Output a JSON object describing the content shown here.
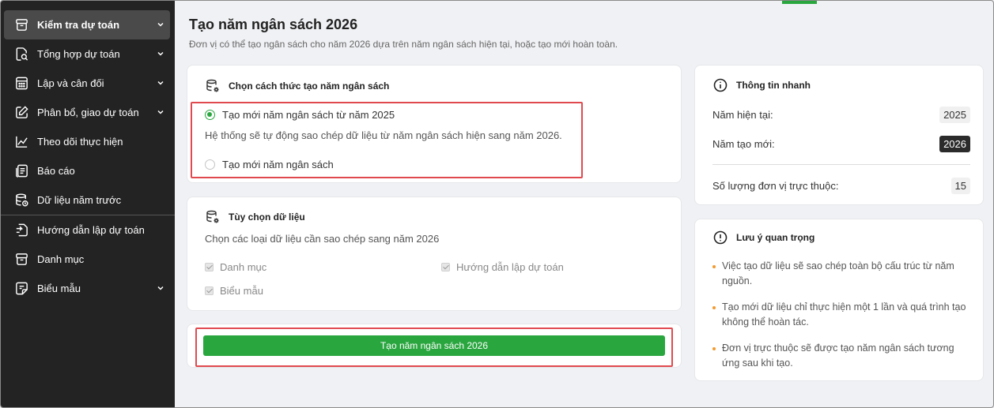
{
  "sidebar": {
    "items": [
      {
        "label": "Kiểm tra dự toán",
        "icon": "box-icon",
        "active": true,
        "has_chevron": true
      },
      {
        "label": "Tổng hợp dự toán",
        "icon": "document-search-icon",
        "has_chevron": true
      },
      {
        "label": "Lập và cân đối",
        "icon": "calculator-icon",
        "has_chevron": true
      },
      {
        "label": "Phân bổ, giao dự toán",
        "icon": "edit-icon",
        "has_chevron": true
      },
      {
        "label": "Theo dõi thực hiện",
        "icon": "line-chart-icon",
        "has_chevron": false
      },
      {
        "label": "Báo cáo",
        "icon": "report-icon",
        "has_chevron": false
      },
      {
        "label": "Dữ liệu năm trước",
        "icon": "database-clock-icon",
        "has_chevron": false
      },
      {
        "label": "Hướng dẫn lập dự toán",
        "icon": "guide-icon",
        "has_chevron": false
      },
      {
        "label": "Danh mục",
        "icon": "box-icon",
        "has_chevron": false
      },
      {
        "label": "Biểu mẫu",
        "icon": "form-icon",
        "has_chevron": true
      }
    ]
  },
  "page": {
    "title": "Tạo năm ngân sách 2026",
    "subtitle": "Đơn vị có thể tạo ngân sách cho năm 2026 dựa trên năm ngân sách hiện tại, hoặc tạo mới hoàn toàn."
  },
  "method_card": {
    "title": "Chọn cách thức tạo năm ngân sách",
    "option_copy": "Tạo mới năm ngân sách từ năm 2025",
    "option_copy_desc": "Hệ thống sẽ tự động sao chép dữ liệu từ năm ngân sách hiện sang năm 2026.",
    "option_new": "Tạo mới năm ngân sách",
    "selected": "option_copy"
  },
  "options_card": {
    "title": "Tùy chọn dữ liệu",
    "description": "Chọn các loại dữ liệu cần sao chép sang năm 2026",
    "checkboxes": {
      "danh_muc": "Danh mục",
      "huong_dan": "Hướng dẫn lập dự toán",
      "bieu_mau": "Biểu mẫu"
    }
  },
  "action": {
    "create_label": "Tạo năm ngân sách 2026"
  },
  "info_card": {
    "title": "Thông tin nhanh",
    "current_year_label": "Năm hiện tại:",
    "current_year_value": "2025",
    "new_year_label": "Năm tạo mới:",
    "new_year_value": "2026",
    "units_label": "Số lượng đơn vị trực thuộc:",
    "units_value": "15"
  },
  "notes_card": {
    "title": "Lưu ý quan trọng",
    "notes": [
      "Việc tạo dữ liệu sẽ sao chép toàn bộ cấu trúc từ năm nguồn.",
      "Tạo mới dữ liệu chỉ thực hiện một 1 lần và quá trình tạo không thể hoàn tác.",
      "Đơn vị trực thuộc sẽ được tạo năm ngân sách tương ứng sau khi tạo."
    ]
  },
  "colors": {
    "accent": "#2aa63f",
    "highlight_border": "#e04a4f",
    "sidebar_bg": "#232323",
    "note_bullet": "#f39a2e"
  }
}
